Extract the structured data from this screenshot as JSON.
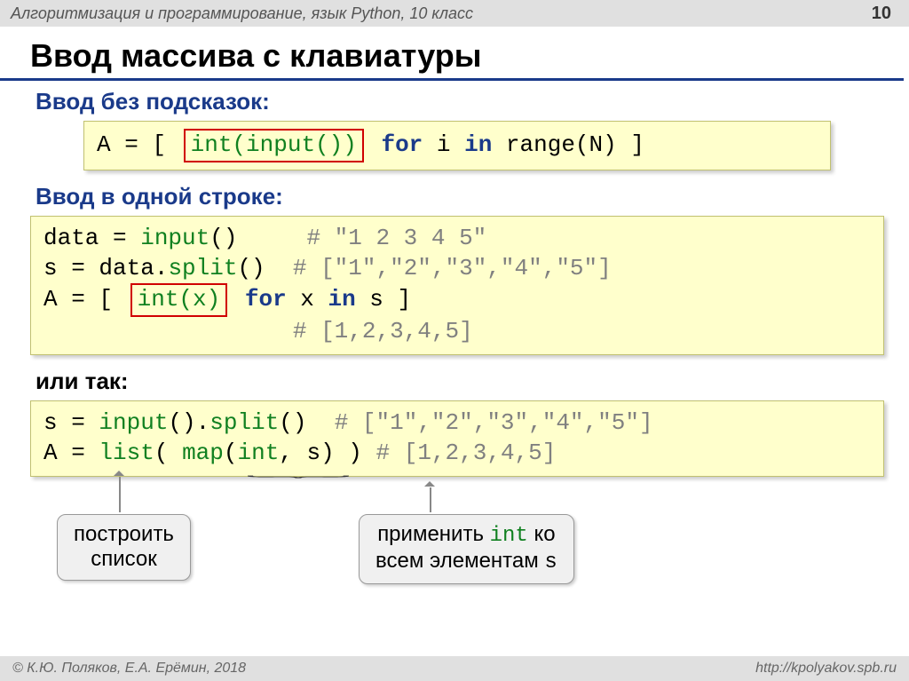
{
  "header": {
    "course": "Алгоритмизация и программирование, язык Python, 10 класс",
    "page": "10"
  },
  "title": "Ввод массива с клавиатуры",
  "section1": {
    "heading": "Ввод без подсказок:",
    "code_pre": "A = [",
    "code_box": "int(input())",
    "code_for": "for",
    "code_i": " i ",
    "code_in": "in",
    "code_range": " range(N) ]"
  },
  "section2": {
    "heading": "Ввод в одной строке:",
    "line1_a": "data = ",
    "line1_b": "input",
    "line1_c": "()     ",
    "line1_d": "# \"1 2 3 4 5\"",
    "line2_a": "s = data.",
    "line2_b": "split",
    "line2_c": "()  ",
    "line2_d": "# [\"1\",\"2\",\"3\",\"4\",\"5\"]",
    "line3_a": "A = [",
    "line3_box": "int(x)",
    "line3_for": "for",
    "line3_x": " x ",
    "line3_in": "in",
    "line3_s": " s ] ",
    "line4_pad": "                  ",
    "line4": "# [1,2,3,4,5]"
  },
  "section3": {
    "heading": "или так:",
    "line1_a": "s = ",
    "line1_b": "input",
    "line1_c": "().",
    "line1_d": "split",
    "line1_e": "()  ",
    "line1_f": "# [\"1\",\"2\",\"3\",\"4\",\"5\"]",
    "line2_a": "A = ",
    "line2_b": "list",
    "line2_c": "( ",
    "line2_d": "map",
    "line2_e": "(",
    "line2_f": "int",
    "line2_g": ", s) ) ",
    "line2_h": "# [1,2,3,4,5]"
  },
  "callout1": {
    "l1": "построить",
    "l2": "список"
  },
  "callout2": {
    "l1": "применить ",
    "l1b": "int",
    "l1c": " ко",
    "l2": "всем элементам ",
    "l2b": "s"
  },
  "footer": {
    "left": "© К.Ю. Поляков, Е.А. Ерёмин, 2018",
    "right": "http://kpolyakov.spb.ru"
  }
}
